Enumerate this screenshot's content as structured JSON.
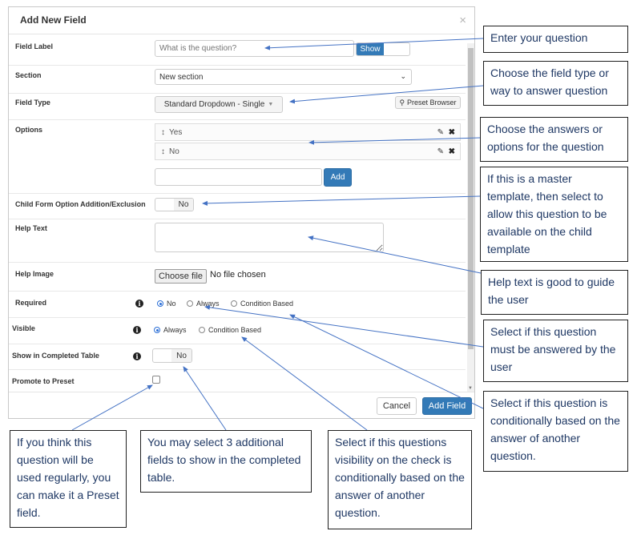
{
  "dialog": {
    "title": "Add New Field",
    "close_icon": "×",
    "fields": {
      "field_label": {
        "label": "Field Label",
        "placeholder": "What is the question?",
        "show_label": "Show"
      },
      "section": {
        "label": "Section",
        "value": "New section"
      },
      "field_type": {
        "label": "Field Type",
        "value": "Standard Dropdown - Single",
        "preset_browser_label": "Preset Browser"
      },
      "options": {
        "label": "Options",
        "items": [
          {
            "text": "Yes"
          },
          {
            "text": "No"
          }
        ],
        "add_label": "Add"
      },
      "child_form": {
        "label": "Child Form Option Addition/Exclusion",
        "value": "No"
      },
      "help_text": {
        "label": "Help Text"
      },
      "help_image": {
        "label": "Help Image",
        "button_label": "Choose file",
        "status": "No file chosen"
      },
      "required": {
        "label": "Required",
        "options": [
          "No",
          "Always",
          "Condition Based"
        ],
        "selected": "No"
      },
      "visible": {
        "label": "Visible",
        "options": [
          "Always",
          "Condition Based"
        ],
        "selected": "Always"
      },
      "show_in_completed": {
        "label": "Show in Completed Table",
        "value": "No"
      },
      "promote": {
        "label": "Promote to Preset"
      }
    },
    "footer": {
      "cancel_label": "Cancel",
      "add_field_label": "Add Field"
    }
  },
  "callouts": {
    "question": "Enter your question",
    "field_type": "Choose the field type or way to answer question",
    "options": "Choose the answers or options for the question",
    "master_template": "If this is a master template, then select to allow this question to be available on the child template",
    "help_text": "Help text is good to guide the user",
    "required": "Select if this question must be answered by the user",
    "conditional": "Select if this question is conditionally based on the answer of another question.",
    "preset": "If you think this question will be used regularly, you can make it a Preset field.",
    "completed_table": "You may select 3 additional fields to show in the completed table.",
    "visibility": "Select if this questions visibility on the check is conditionally based on the answer of another question."
  },
  "colors": {
    "primary": "#337ab7",
    "callout_text": "#1f3864",
    "arrow": "#4472c4"
  }
}
